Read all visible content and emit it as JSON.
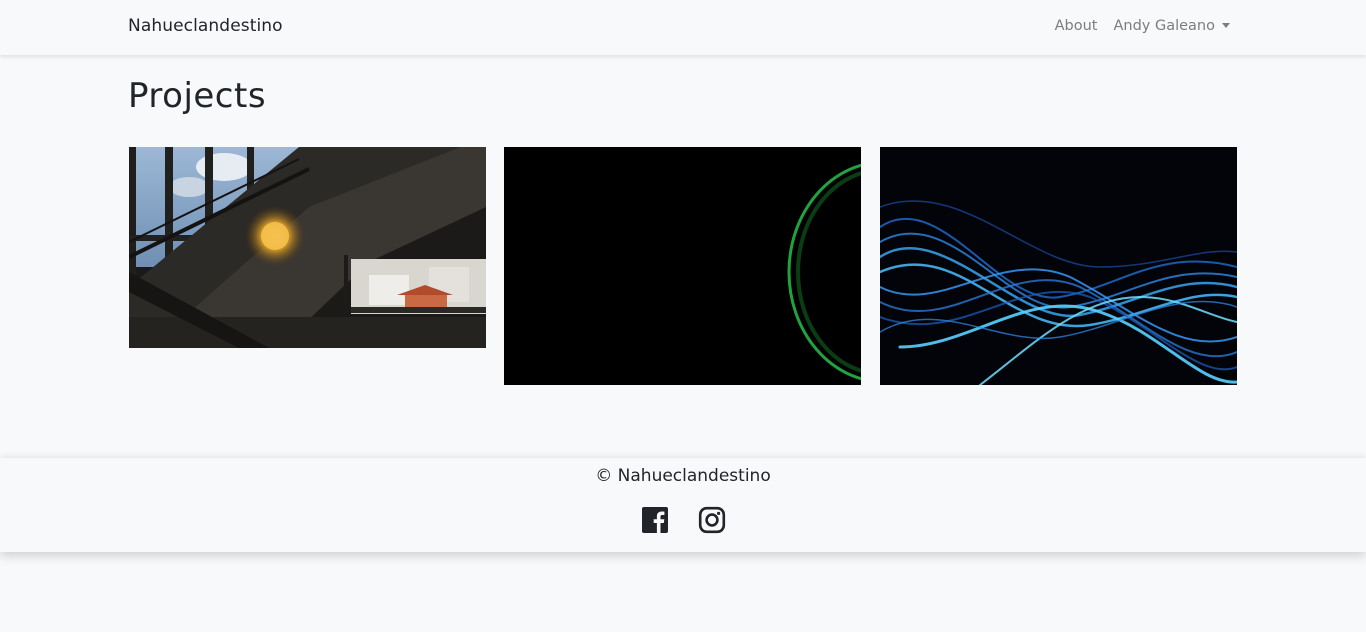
{
  "navbar": {
    "brand": "Nahueclandestino",
    "links": [
      {
        "label": "About"
      },
      {
        "label": "Andy Galeano"
      }
    ]
  },
  "main": {
    "title": "Projects",
    "projects": [
      {
        "image": "staircase-lamp-photo"
      },
      {
        "image": "green-blue-ring-photo"
      },
      {
        "image": "blue-light-waves-photo"
      }
    ]
  },
  "footer": {
    "copyright": "© Nahueclandestino",
    "social": [
      {
        "icon": "facebook-icon"
      },
      {
        "icon": "instagram-icon"
      }
    ]
  },
  "colors": {
    "background": "#f8f9fa",
    "text": "#212529",
    "nav_link": "#7d7d7d"
  }
}
